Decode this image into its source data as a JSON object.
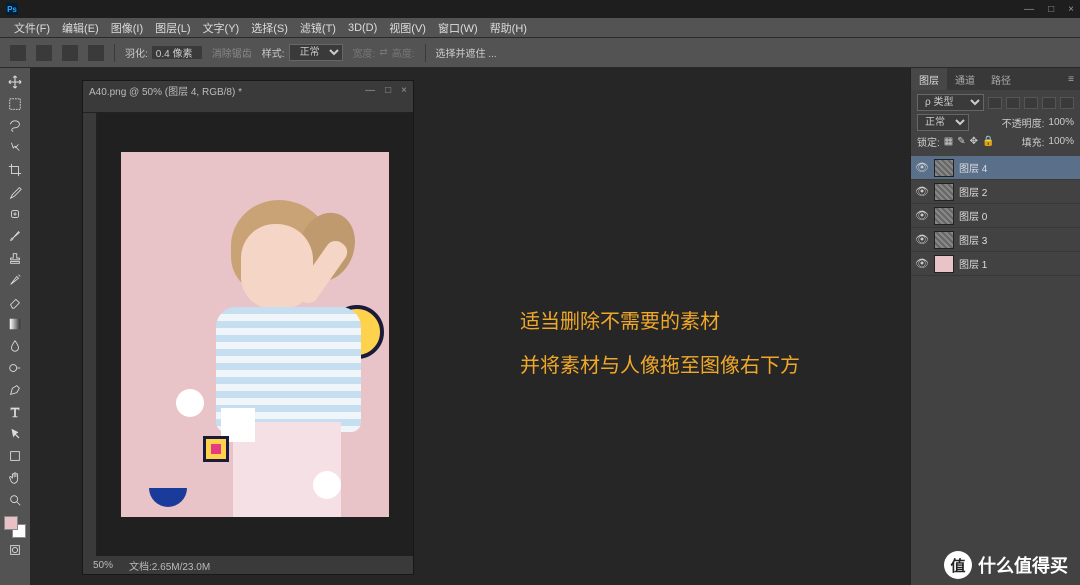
{
  "titlebar": {
    "logo": "Ps",
    "min": "—",
    "max": "□",
    "close": "×"
  },
  "menu": [
    "文件(F)",
    "编辑(E)",
    "图像(I)",
    "图层(L)",
    "文字(Y)",
    "选择(S)",
    "滤镜(T)",
    "3D(D)",
    "视图(V)",
    "窗口(W)",
    "帮助(H)"
  ],
  "options": {
    "feather_label": "羽化:",
    "feather_value": "0.4 像素",
    "antialias": "消除锯齿",
    "style_label": "样式:",
    "style_value": "正常",
    "width_label": "宽度:",
    "height_label": "高度:",
    "selectmask": "选择并遮住 ..."
  },
  "document": {
    "title": "A40.png @ 50% (图层 4, RGB/8) *",
    "zoom": "50%",
    "filesize": "文档:2.65M/23.0M",
    "min": "—",
    "max": "□",
    "close": "×"
  },
  "annotation": {
    "line1": "适当删除不需要的素材",
    "line2": "并将素材与人像拖至图像右下方"
  },
  "panel": {
    "tabs": [
      "图层",
      "通道",
      "路径"
    ],
    "kind_label": "ρ 类型",
    "blend": "正常",
    "opacity_label": "不透明度:",
    "opacity_value": "100%",
    "lock_label": "锁定:",
    "fill_label": "填充:",
    "fill_value": "100%",
    "layers": [
      {
        "name": "图层 4",
        "selected": true,
        "solid": false
      },
      {
        "name": "图层 2",
        "selected": false,
        "solid": false
      },
      {
        "name": "图层 0",
        "selected": false,
        "solid": false
      },
      {
        "name": "图层 3",
        "selected": false,
        "solid": false
      },
      {
        "name": "图层 1",
        "selected": false,
        "solid": true
      }
    ]
  },
  "watermark": {
    "badge": "值",
    "text": "什么值得买"
  }
}
